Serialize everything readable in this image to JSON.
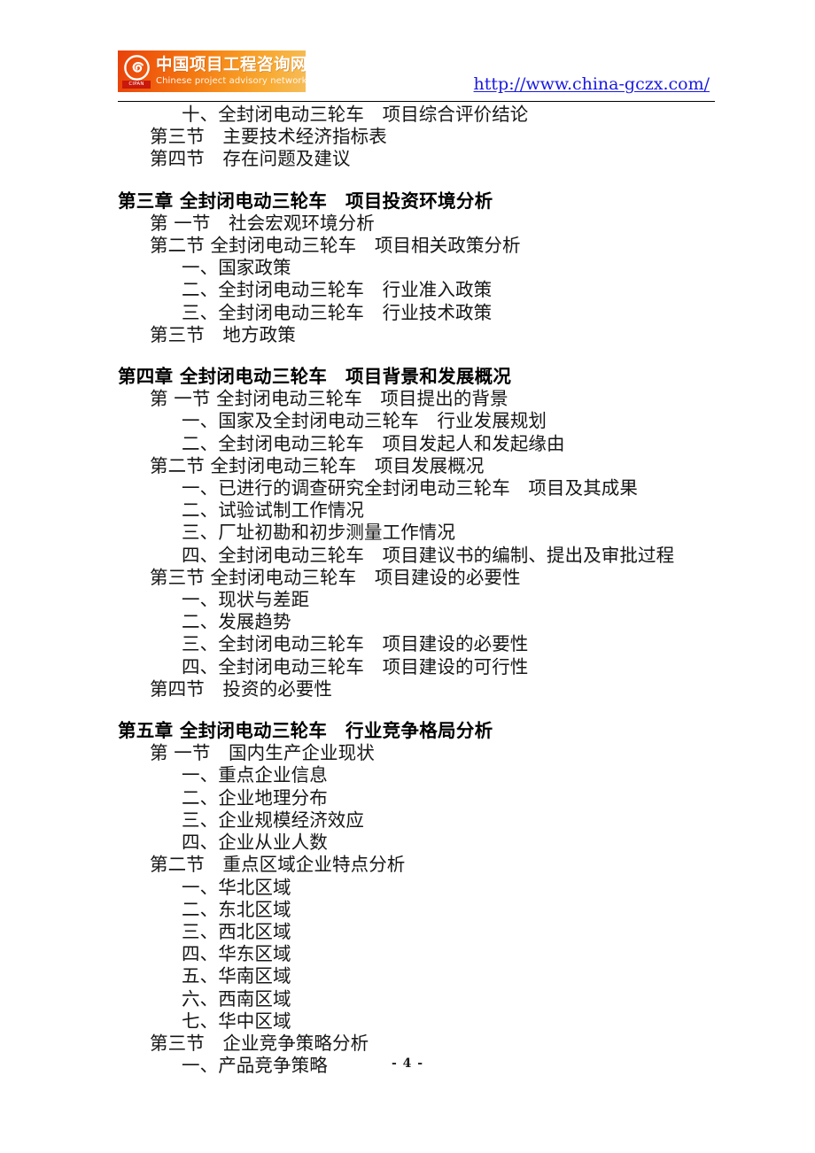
{
  "header": {
    "logo": {
      "chinese_name": "中国项目工程咨询网",
      "english_name": "Chinese project advisory network",
      "mark_caption": "CIPAN",
      "icon": "spiral-swirl-icon",
      "bg_start_color": "#e8410b",
      "bg_end_color": "#f6bd58"
    },
    "url": "http://www.china-gczx.com/",
    "url_color": "#1a1ae0"
  },
  "toc": {
    "lines": [
      {
        "level": "item",
        "text": "十、全封闭电动三轮车　项目综合评价结论"
      },
      {
        "level": "section",
        "text": "第三节　主要技术经济指标表"
      },
      {
        "level": "section",
        "text": "第四节　存在问题及建议"
      },
      {
        "level": "chapter",
        "text": "第三章 全封闭电动三轮车　项目投资环境分析"
      },
      {
        "level": "section",
        "text": "第 一节　社会宏观环境分析"
      },
      {
        "level": "section",
        "text": "第二节 全封闭电动三轮车　项目相关政策分析"
      },
      {
        "level": "item",
        "text": "一、国家政策"
      },
      {
        "level": "item",
        "text": "二、全封闭电动三轮车　行业准入政策"
      },
      {
        "level": "item",
        "text": "三、全封闭电动三轮车　行业技术政策"
      },
      {
        "level": "section",
        "text": "第三节　地方政策"
      },
      {
        "level": "chapter",
        "text": "第四章 全封闭电动三轮车　项目背景和发展概况"
      },
      {
        "level": "section",
        "text": "第 一节 全封闭电动三轮车　项目提出的背景"
      },
      {
        "level": "item",
        "text": "一、国家及全封闭电动三轮车　行业发展规划"
      },
      {
        "level": "item",
        "text": "二、全封闭电动三轮车　项目发起人和发起缘由"
      },
      {
        "level": "section",
        "text": "第二节 全封闭电动三轮车　项目发展概况"
      },
      {
        "level": "item",
        "text": "一、已进行的调查研究全封闭电动三轮车　项目及其成果"
      },
      {
        "level": "item",
        "text": "二、试验试制工作情况"
      },
      {
        "level": "item",
        "text": "三、厂址初勘和初步测量工作情况"
      },
      {
        "level": "item",
        "text": "四、全封闭电动三轮车　项目建议书的编制、提出及审批过程"
      },
      {
        "level": "section",
        "text": "第三节 全封闭电动三轮车　项目建设的必要性"
      },
      {
        "level": "item",
        "text": "一、现状与差距"
      },
      {
        "level": "item",
        "text": "二、发展趋势"
      },
      {
        "level": "item",
        "text": "三、全封闭电动三轮车　项目建设的必要性"
      },
      {
        "level": "item",
        "text": "四、全封闭电动三轮车　项目建设的可行性"
      },
      {
        "level": "section",
        "text": "第四节　投资的必要性"
      },
      {
        "level": "chapter",
        "text": "第五章 全封闭电动三轮车　行业竞争格局分析"
      },
      {
        "level": "section",
        "text": "第 一节　国内生产企业现状"
      },
      {
        "level": "item",
        "text": "一、重点企业信息"
      },
      {
        "level": "item",
        "text": "二、企业地理分布"
      },
      {
        "level": "item",
        "text": "三、企业规模经济效应"
      },
      {
        "level": "item",
        "text": "四、企业从业人数"
      },
      {
        "level": "section",
        "text": "第二节　重点区域企业特点分析"
      },
      {
        "level": "item",
        "text": "一、华北区域"
      },
      {
        "level": "item",
        "text": "二、东北区域"
      },
      {
        "level": "item",
        "text": "三、西北区域"
      },
      {
        "level": "item",
        "text": "四、华东区域"
      },
      {
        "level": "item",
        "text": "五、华南区域"
      },
      {
        "level": "item",
        "text": "六、西南区域"
      },
      {
        "level": "item",
        "text": "七、华中区域"
      },
      {
        "level": "section",
        "text": "第三节　企业竞争策略分析"
      },
      {
        "level": "item",
        "text": "一、产品竞争策略"
      }
    ]
  },
  "footer": {
    "page_number": "- 4 -"
  }
}
